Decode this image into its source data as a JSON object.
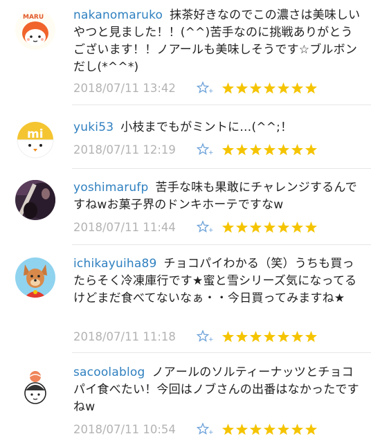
{
  "colors": {
    "username": "#2f80c0",
    "date": "#b3b3b3",
    "star": "#f5c400",
    "star_add": "#6aa0d8"
  },
  "comments": [
    {
      "user": "nakanomaruko",
      "text": "抹茶好きなのでこの濃さは美味しいやつと見ました！！(^^)苦手なのに挑戦ありがとうございます！！ノアールも美味しそうです☆ブルボンだし(*^^*)",
      "date": "2018/07/11 13:42",
      "star_count": 7,
      "avatar_icon": "maru-character-avatar-icon",
      "avatar_label": "MARU"
    },
    {
      "user": "yuki53",
      "text": "小枝までもがミントに…(^^;！",
      "date": "2018/07/11 12:19",
      "star_count": 7,
      "avatar_icon": "mi-chick-avatar-icon",
      "avatar_label": "mi"
    },
    {
      "user": "yoshimarufp",
      "text": "苦手な味も果敢にチャレンジするんですねwお菓子界のドンキホーテですなw",
      "date": "2018/07/11 11:44",
      "star_count": 7,
      "avatar_icon": "guitar-photo-avatar-icon"
    },
    {
      "user": "ichikayuiha89",
      "text": "チョコパイわかる（笑）うちも買ったらそく冷凍庫行です★蜜と雪シリーズ気になってるけどまだ食べてないなぁ・・今日買ってみますね★",
      "date": "2018/07/11 11:18",
      "star_count": 7,
      "avatar_icon": "dog-character-avatar-icon"
    },
    {
      "user": "sacoolablog",
      "text": "ノアールのソルティーナッツとチョコパイ食べたい！今回はノブさんの出番はなかったですねw",
      "date": "2018/07/11 10:54",
      "star_count": 7,
      "avatar_icon": "girl-illustration-avatar-icon"
    }
  ]
}
